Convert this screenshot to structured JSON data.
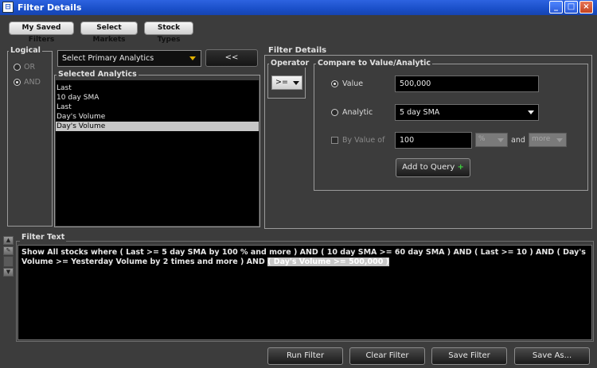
{
  "window": {
    "title": "Filter Details",
    "minimize": "_",
    "maximize": "□",
    "close": "×"
  },
  "toolbar": {
    "saved_filters": "My Saved Filters",
    "select_markets": "Select Markets",
    "stock_types": "Stock Types"
  },
  "logical": {
    "legend": "Logical",
    "options": [
      "OR",
      "AND"
    ],
    "selected": "AND"
  },
  "analytics": {
    "dropdown": "Select Primary Analytics",
    "remove_button": "<<",
    "selected_legend": "Selected Analytics",
    "items": [
      "Last",
      "10 day SMA",
      "Last",
      "Day's Volume",
      "Day's Volume"
    ],
    "selected_index": 4
  },
  "filter_details": {
    "legend": "Filter Details",
    "operator_legend": "Operator",
    "operator_value": ">=",
    "compare_legend": "Compare to Value/Analytic",
    "value_label": "Value",
    "value_input": "500,000",
    "analytic_label": "Analytic",
    "analytic_value": "5 day SMA",
    "by_value_label": "By Value of",
    "by_value_input": "100",
    "unit_select": "%",
    "and_label": "and",
    "more_select": "more",
    "add_button": "Add to Query",
    "add_icon_glyph": "+"
  },
  "filter_text": {
    "legend": "Filter Text",
    "prefix": "Show All stocks where  ( Last  >=  5 day SMA by 100 % and more ) AND ( 10 day SMA  >=  60 day SMA ) AND ( Last  >=  10 ) AND ( Day's Volume  >=  Yesterday Volume by 2 times and more ) AND ",
    "highlighted": "( Day's Volume  >=  500,000 )"
  },
  "side_icons": [
    "move-up-icon",
    "edit-icon",
    "move-down-icon"
  ],
  "bottom_buttons": {
    "run": "Run Filter",
    "clear": "Clear Filter",
    "save": "Save Filter",
    "save_as": "Save As..."
  },
  "colors": {
    "titlebar": "#1a4fc8",
    "background": "#3c3c3c",
    "panel": "#000000",
    "accent_arrow": "#e0b000",
    "plus_green": "#3fd23f"
  }
}
